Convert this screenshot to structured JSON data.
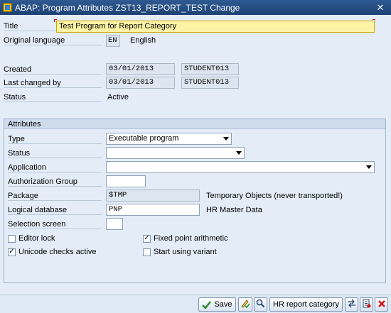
{
  "window": {
    "title": "ABAP: Program Attributes ZST13_REPORT_TEST Change"
  },
  "header": {
    "title_label": "Title",
    "title_value": "Test Program for Report Category",
    "orig_lang_label": "Original language",
    "orig_lang_code": "EN",
    "orig_lang_name": "English",
    "created_label": "Created",
    "created_date": "03/01/2013",
    "created_user": "STUDENT013",
    "changed_label": "Last changed by",
    "changed_date": "03/01/2013",
    "changed_user": "STUDENT013",
    "status_label": "Status",
    "status_value": "Active"
  },
  "attributes": {
    "group_title": "Attributes",
    "type_label": "Type",
    "type_value": "Executable program",
    "status_label": "Status",
    "status_value": "",
    "application_label": "Application",
    "application_value": "",
    "auth_group_label": "Authorization Group",
    "auth_group_value": "",
    "package_label": "Package",
    "package_value": "$TMP",
    "package_desc": "Temporary Objects (never transported!)",
    "logdb_label": "Logical database",
    "logdb_value": "PNP",
    "logdb_desc": "HR Master Data",
    "selscreen_label": "Selection screen",
    "selscreen_value": "",
    "editor_lock_label": "Editor lock",
    "editor_lock_checked": false,
    "fixed_point_label": "Fixed point arithmetic",
    "fixed_point_checked": true,
    "unicode_label": "Unicode checks active",
    "unicode_checked": true,
    "start_variant_label": "Start using variant",
    "start_variant_checked": false
  },
  "toolbar": {
    "save_label": "Save",
    "hr_report_label": "HR report category"
  },
  "colors": {
    "titlebar": "#1d4174",
    "accent_green": "#2e8b2e",
    "mandatory_red": "#d01010"
  }
}
